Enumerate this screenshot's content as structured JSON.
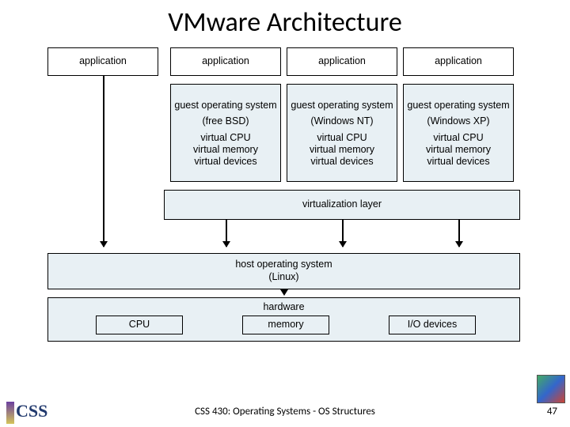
{
  "title": "VMware Architecture",
  "applications": [
    "application",
    "application",
    "application",
    "application"
  ],
  "guests": [
    {
      "os": "guest operating system",
      "example": "(free BSD)",
      "v1": "virtual CPU",
      "v2": "virtual memory",
      "v3": "virtual devices"
    },
    {
      "os": "guest operating system",
      "example": "(Windows NT)",
      "v1": "virtual CPU",
      "v2": "virtual memory",
      "v3": "virtual devices"
    },
    {
      "os": "guest operating system",
      "example": "(Windows XP)",
      "v1": "virtual CPU",
      "v2": "virtual memory",
      "v3": "virtual devices"
    }
  ],
  "virt_layer": "virtualization layer",
  "host_os": {
    "line1": "host operating system",
    "line2": "(Linux)"
  },
  "hardware": {
    "label": "hardware",
    "cpu": "CPU",
    "memory": "memory",
    "io": "I/O devices"
  },
  "footer": "CSS 430: Operating Systems - OS Structures",
  "page_number": "47",
  "logo_text": "CSS"
}
